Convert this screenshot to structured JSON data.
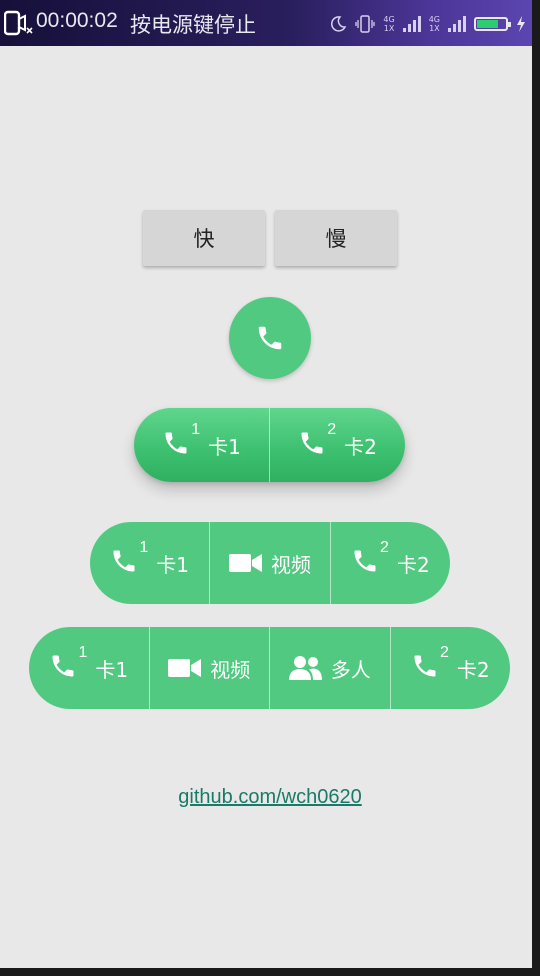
{
  "status_bar": {
    "record_time": "00:00:02",
    "record_hint": "按电源键停止",
    "network_top": "4G",
    "network_bottom": "1X",
    "network2_top": "4G",
    "network2_bottom": "1X",
    "battery_level": 0.75,
    "icons": [
      "screen-record-icon",
      "moon-icon",
      "vibrate-icon",
      "signal-icon",
      "battery-icon",
      "charging-icon"
    ]
  },
  "speed_buttons": {
    "fast_label": "快",
    "slow_label": "慢"
  },
  "call_button": {
    "icon": "phone-icon"
  },
  "bar_two": {
    "items": [
      {
        "sup": "1",
        "label": "卡1",
        "icon": "phone-icon"
      },
      {
        "sup": "2",
        "label": "卡2",
        "icon": "phone-icon"
      }
    ]
  },
  "bar_three": {
    "items": [
      {
        "sup": "1",
        "label": "卡1",
        "icon": "phone-icon"
      },
      {
        "label": "视频",
        "icon": "video-icon"
      },
      {
        "sup": "2",
        "label": "卡2",
        "icon": "phone-icon"
      }
    ]
  },
  "bar_four": {
    "items": [
      {
        "sup": "1",
        "label": "卡1",
        "icon": "phone-icon"
      },
      {
        "label": "视频",
        "icon": "video-icon"
      },
      {
        "label": "多人",
        "icon": "group-icon"
      },
      {
        "sup": "2",
        "label": "卡2",
        "icon": "phone-icon"
      }
    ]
  },
  "footer": {
    "link_text": "github.com/wch0620"
  },
  "colors": {
    "accent_green": "#52c981",
    "background": "#e8e8e8",
    "link": "#1a7a68"
  }
}
